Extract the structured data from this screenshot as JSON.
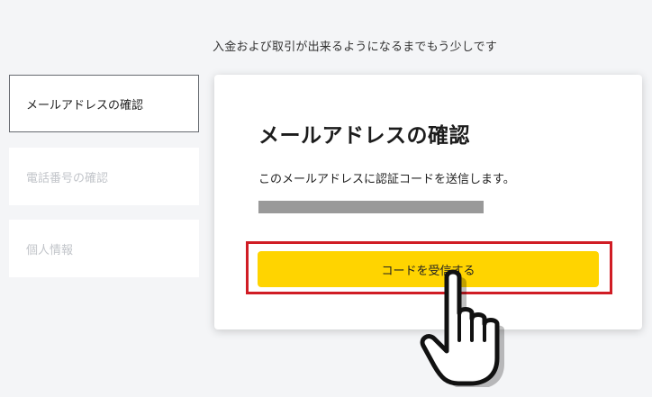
{
  "header": {
    "note": "入金および取引が出来るようになるまでもう少しです"
  },
  "steps": [
    {
      "label": "メールアドレスの確認",
      "state": "active"
    },
    {
      "label": "電話番号の確認",
      "state": "inactive"
    },
    {
      "label": "個人情報",
      "state": "inactive"
    }
  ],
  "card": {
    "title": "メールアドレスの確認",
    "description": "このメールアドレスに認証コードを送信します。",
    "button_label": "コードを受信する"
  },
  "colors": {
    "button": "#ffd400",
    "highlight_border": "#d01c24",
    "mask": "#999999",
    "background": "#f4f5f7"
  },
  "icons": {
    "cursor": "pointing-hand-cursor-icon"
  }
}
